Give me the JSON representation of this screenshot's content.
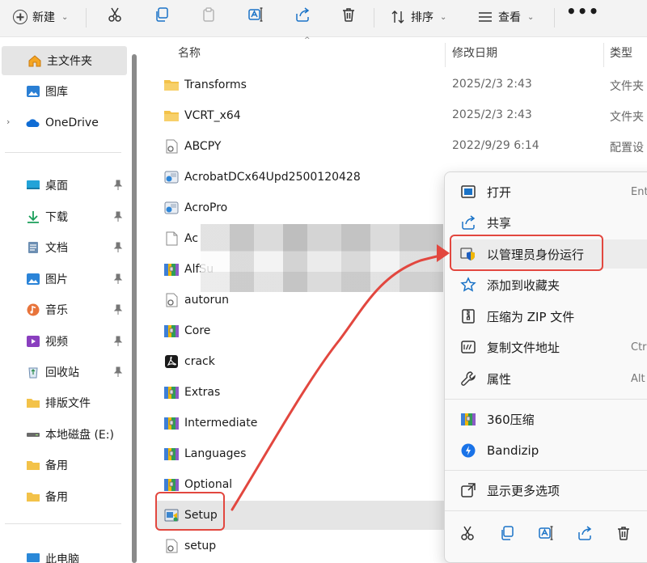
{
  "toolbar": {
    "new_label": "新建",
    "sort_label": "排序",
    "view_label": "查看",
    "more_label": "•••"
  },
  "sidebar": {
    "items": [
      {
        "label": "主文件夹",
        "icon": "home-icon",
        "selected": true
      },
      {
        "label": "图库",
        "icon": "gallery-icon"
      },
      {
        "label": "OneDrive",
        "icon": "onedrive-cloud-icon",
        "expandable": true
      },
      {
        "label": "桌面",
        "icon": "desktop-icon",
        "pinned": true
      },
      {
        "label": "下载",
        "icon": "download-icon",
        "pinned": true
      },
      {
        "label": "文档",
        "icon": "documents-icon",
        "pinned": true
      },
      {
        "label": "图片",
        "icon": "pictures-icon",
        "pinned": true
      },
      {
        "label": "音乐",
        "icon": "music-icon",
        "pinned": true
      },
      {
        "label": "视频",
        "icon": "videos-icon",
        "pinned": true
      },
      {
        "label": "回收站",
        "icon": "recycle-bin-icon",
        "pinned": true
      },
      {
        "label": "排版文件",
        "icon": "folder-icon"
      },
      {
        "label": "本地磁盘 (E:)",
        "icon": "drive-icon"
      },
      {
        "label": "备用",
        "icon": "folder-icon"
      },
      {
        "label": "备用",
        "icon": "folder-icon"
      },
      {
        "label": "此电脑",
        "icon": "this-pc-icon"
      }
    ]
  },
  "columns": {
    "name": "名称",
    "modified": "修改日期",
    "type": "类型"
  },
  "files": [
    {
      "name": "Transforms",
      "date": "2025/2/3 2:43",
      "type": "文件夹",
      "icon": "folder-icon"
    },
    {
      "name": "VCRT_x64",
      "date": "2025/2/3 2:43",
      "type": "文件夹",
      "icon": "folder-icon"
    },
    {
      "name": "ABCPY",
      "date": "2022/9/29 6:14",
      "type": "配置设",
      "icon": "config-file-icon"
    },
    {
      "name": "AcrobatDCx64Upd2500120428",
      "date": "",
      "type": "",
      "icon": "installer-package-icon"
    },
    {
      "name": "AcroPro",
      "date": "",
      "type": "",
      "icon": "installer-package-icon"
    },
    {
      "name": "Ac",
      "date": "",
      "type": "",
      "icon": "blank-file-icon"
    },
    {
      "name": "AlfSu",
      "date": "",
      "type": "",
      "icon": "winrar-archive-icon"
    },
    {
      "name": "autorun",
      "date": "",
      "type": "",
      "icon": "config-file-icon"
    },
    {
      "name": "Core",
      "date": "",
      "type": "",
      "icon": "winrar-archive-icon"
    },
    {
      "name": "crack",
      "date": "",
      "type": "",
      "icon": "acrobat-icon"
    },
    {
      "name": "Extras",
      "date": "",
      "type": "",
      "icon": "winrar-archive-icon"
    },
    {
      "name": "Intermediate",
      "date": "",
      "type": "",
      "icon": "winrar-archive-icon"
    },
    {
      "name": "Languages",
      "date": "",
      "type": "",
      "icon": "winrar-archive-icon"
    },
    {
      "name": "Optional",
      "date": "",
      "type": "",
      "icon": "winrar-archive-icon"
    },
    {
      "name": "Setup",
      "date": "",
      "type": "",
      "icon": "setup-exe-icon",
      "selected": true
    },
    {
      "name": "setup",
      "date": "",
      "type": "",
      "icon": "config-file-icon"
    }
  ],
  "context_menu": {
    "items": [
      {
        "label": "打开",
        "shortcut": "Ent",
        "icon": "open-icon"
      },
      {
        "label": "共享",
        "shortcut": "",
        "icon": "share-icon"
      },
      {
        "label": "以管理员身份运行",
        "shortcut": "",
        "icon": "admin-shield-icon",
        "highlighted": true
      },
      {
        "label": "添加到收藏夹",
        "shortcut": "",
        "icon": "star-icon"
      },
      {
        "label": "压缩为 ZIP 文件",
        "shortcut": "",
        "icon": "zip-icon"
      },
      {
        "label": "复制文件地址",
        "shortcut": "Ctrl",
        "icon": "copy-path-icon"
      },
      {
        "label": "属性",
        "shortcut": "Alt",
        "icon": "wrench-icon"
      },
      {
        "label": "360压缩",
        "shortcut": "",
        "icon": "360-compress-icon"
      },
      {
        "label": "Bandizip",
        "shortcut": "",
        "icon": "bandizip-icon"
      },
      {
        "label": "显示更多选项",
        "shortcut": "",
        "icon": "more-options-icon"
      }
    ]
  },
  "colors": {
    "accent": "#0067c0",
    "highlight": "#e2473f",
    "folder": "#f3c249",
    "selection": "#e5e5e5"
  }
}
